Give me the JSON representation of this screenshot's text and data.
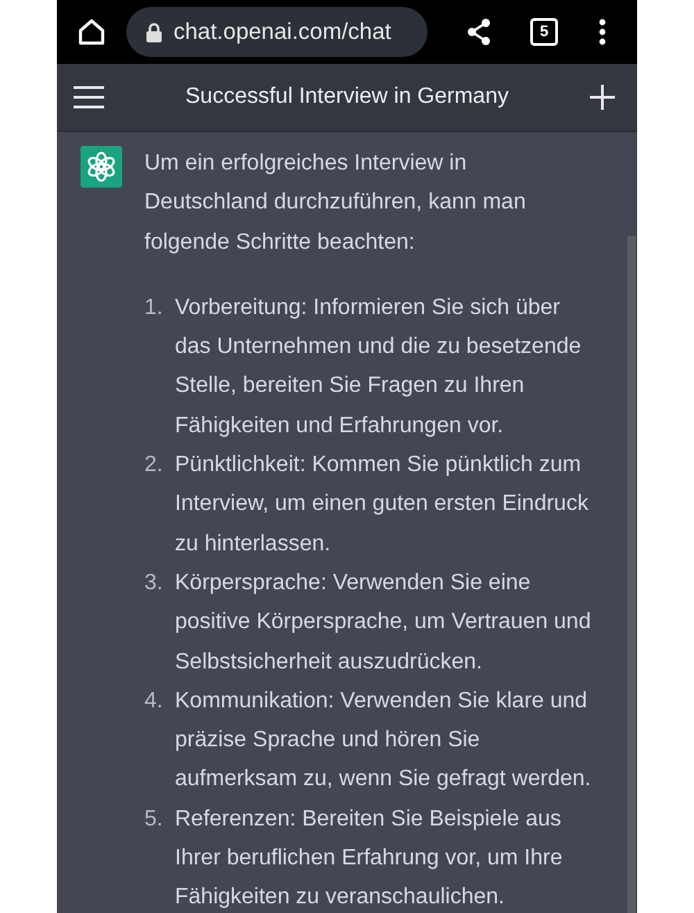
{
  "browser_bar": {
    "url": "chat.openai.com/chat",
    "tab_count": "5"
  },
  "chat_header": {
    "title": "Successful Interview in Germany"
  },
  "message": {
    "intro": "Um ein erfolgreiches Interview in Deutschland durchzuführen, kann man folgende Schritte beachten:",
    "steps": [
      {
        "number": "1.",
        "text": "Vorbereitung: Informieren Sie sich über das Unternehmen und die zu besetzende Stelle, bereiten Sie Fragen zu Ihren Fähigkeiten und Erfahrungen vor."
      },
      {
        "number": "2.",
        "text": "Pünktlichkeit: Kommen Sie pünktlich zum Interview, um einen guten ersten Eindruck zu hinterlassen."
      },
      {
        "number": "3.",
        "text": "Körpersprache: Verwenden Sie eine positive Körpersprache, um Vertrauen und Selbstsicherheit auszudrücken."
      },
      {
        "number": "4.",
        "text": "Kommunikation: Verwenden Sie klare und präzise Sprache und hören Sie aufmerksam zu, wenn Sie gefragt werden."
      },
      {
        "number": "5.",
        "text": "Referenzen: Bereiten Sie Beispiele aus Ihrer beruflichen Erfahrung vor, um Ihre Fähigkeiten zu veranschaulichen."
      }
    ]
  }
}
